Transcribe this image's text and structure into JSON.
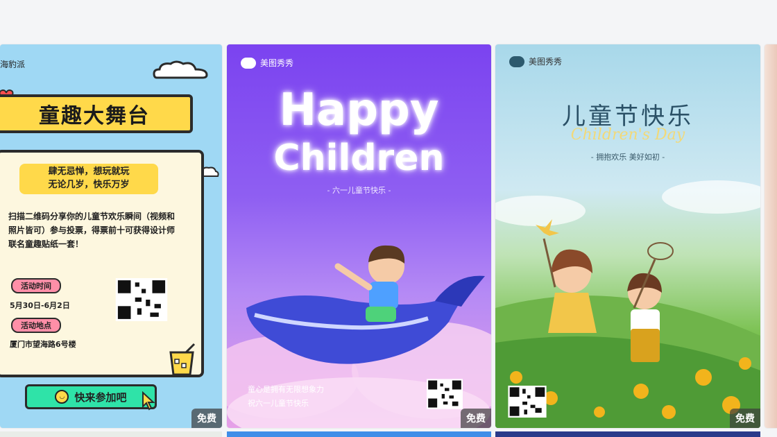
{
  "cards": [
    {
      "top_text": "海豹派",
      "banner": "童趣大舞台",
      "pill_line1": "肆无忌惮，想玩就玩",
      "pill_line2": "无论几岁，快乐万岁",
      "desc": "扫描二维码分享你的儿童节欢乐瞬间（视频和照片皆可）参与投票，得票前十可获得设计师联名童趣贴纸一套！",
      "time_label": "活动时间",
      "time_value": "5月30日-6月2日",
      "place_label": "活动地点",
      "place_value": "厦门市望海路6号楼",
      "cta": "快来参加吧",
      "badge": "免费"
    },
    {
      "brand": "美图秀秀",
      "title1": "Happy",
      "title2": "Children",
      "sub": "- 六一儿童节快乐 -",
      "line1": "童心是拥有无限想象力",
      "line2": "祝六一儿童节快乐",
      "badge": "免费"
    },
    {
      "brand": "美图秀秀",
      "title": "儿童节快乐",
      "script": "Children's Day",
      "sub": "- 拥抱欢乐 美好如初 -",
      "badge": "免费"
    }
  ],
  "colors": {
    "card1_bg": "#9fd8f4",
    "card2_bg": "#7b43f0",
    "card3_bg": "#a8d8ea",
    "badge_bg": "#3c3c3c"
  }
}
